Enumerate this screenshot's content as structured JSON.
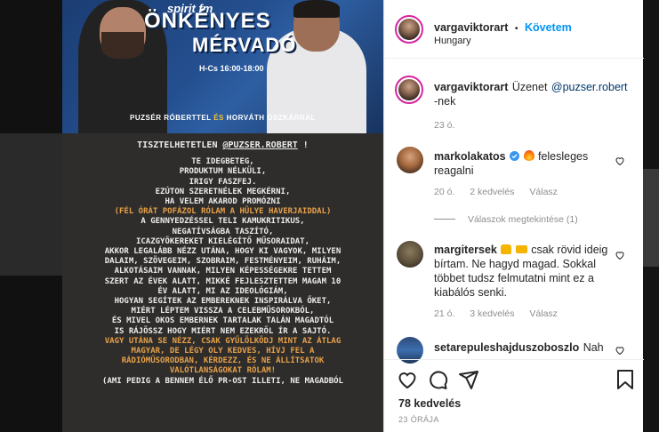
{
  "post_image": {
    "banner": {
      "brand": "spirit fm",
      "title_line1": "ÖNKÉNYES",
      "title_line2": "MÉRVADÓ",
      "schedule": "H-Cs 16:00-18:00",
      "host1": "PUZSÉR RÓBERTTEL",
      "hosts_amp": "ÉS",
      "host2": "HORVÁTH OSZKÁRRAL"
    },
    "message": {
      "greeting_prefix": "TISZTELHETETLEN ",
      "greeting_mention": "@PUZSER.ROBERT",
      "greeting_suffix": " !",
      "block1": "TE IDEGBETEG,\nPRODUKTUM NÉLKÜLI,\nIRIGY FASZFEJ.\nEZÚTON SZERETNÉLEK MEGKÉRNI,\nHA VELEM AKAROD PROMÓZNI",
      "orange1": "(FÉL ÓRÁT POFÁZOL RÓLAM A HÜLYE HAVERJAIDDAL)",
      "block2": "A GENNYEDZÉSSEL TELI KAMUKRITIKUS,\nNEGATÍVSÁGBA TASZÍTÓ,\nICAZGYÖKEREKET KIELÉGÍTŐ MŰSORAIDAT,\nAKKOR LEGALÁBB NÉZZ UTÁNA, HOGY KI VAGYOK, MILYEN\nDALAIM, SZÖVEGEIM, SZOBRAIM, FESTMÉNYEIM, RUHÁIM,\nALKOTÁSAIM VANNAK, MILYEN KÉPESSÉGEKRE TETTEM\nSZERT AZ ÉVEK ALATT, MIKKÉ FEJLESZTETTEM MAGAM 10\nÉV ALATT, MI AZ IDEOLÓGIÁM,\nHOGYAN SEGÍTEK AZ EMBEREKNEK INSPIRÁLVA ŐKET,\nMIÉRT LÉPTEM VISSZA A CELEBMŰSOROKBÓL,\nÉS MIVEL OKOS EMBERNEK TARTALAK TALÁN MAGADTÓL\nIS RÁJÖSSZ HOGY MIÉRT NEM EZEKRŐL ÍR A SAJTÓ.",
      "orange2": "VAGY UTÁNA SE NÉZZ, CSAK GYŰLÖLKÖDJ MINT AZ ÁTLAG\nMAGYAR, DE LÉGY OLY KEDVES, HÍVJ FEL A\nRÁDIÓMŰSORODBAN, KÉRDEZZ, ÉS NE ÁLLÍTSATOK\nVALÓTLANSÁGOKAT RÓLAM!",
      "block3": "(AMI PEDIG A BENNEM ÉLŐ PR-OST ILLETI, NE MAGADBÓL"
    }
  },
  "header": {
    "username": "vargaviktorart",
    "separator": "•",
    "follow_label": "Követem",
    "location": "Hungary"
  },
  "caption": {
    "username": "vargaviktorart",
    "text": "Üzenet",
    "mention": "@puzser.robert",
    "suffix": "-nek",
    "time": "23 ó."
  },
  "comments": [
    {
      "username": "markolakatos",
      "text": "felesleges reagalni",
      "time": "20 ó.",
      "likes": "2 kedvelés",
      "reply": "Válasz",
      "view_replies": "Válaszok megtekintése (1)"
    },
    {
      "username": "margitersek",
      "text": "csak rövid ideig bírtam. Ne hagyd magad. Sokkal többet tudsz felmutatni mint ez a kiabálós senki.",
      "time": "21 ó.",
      "likes": "3 kedvelés",
      "reply": "Válasz"
    },
    {
      "username": "setarepuleshajduszoboszlo",
      "text": "Nah"
    }
  ],
  "actions": {
    "likes": "78 kedvelés",
    "time_ago": "23 ÓRÁJA"
  },
  "colors": {
    "accent": "#0095f6",
    "text": "#262626",
    "muted": "#8e8e8e",
    "message_orange": "#e6a04a",
    "post_bg": "#2e2d2b"
  }
}
